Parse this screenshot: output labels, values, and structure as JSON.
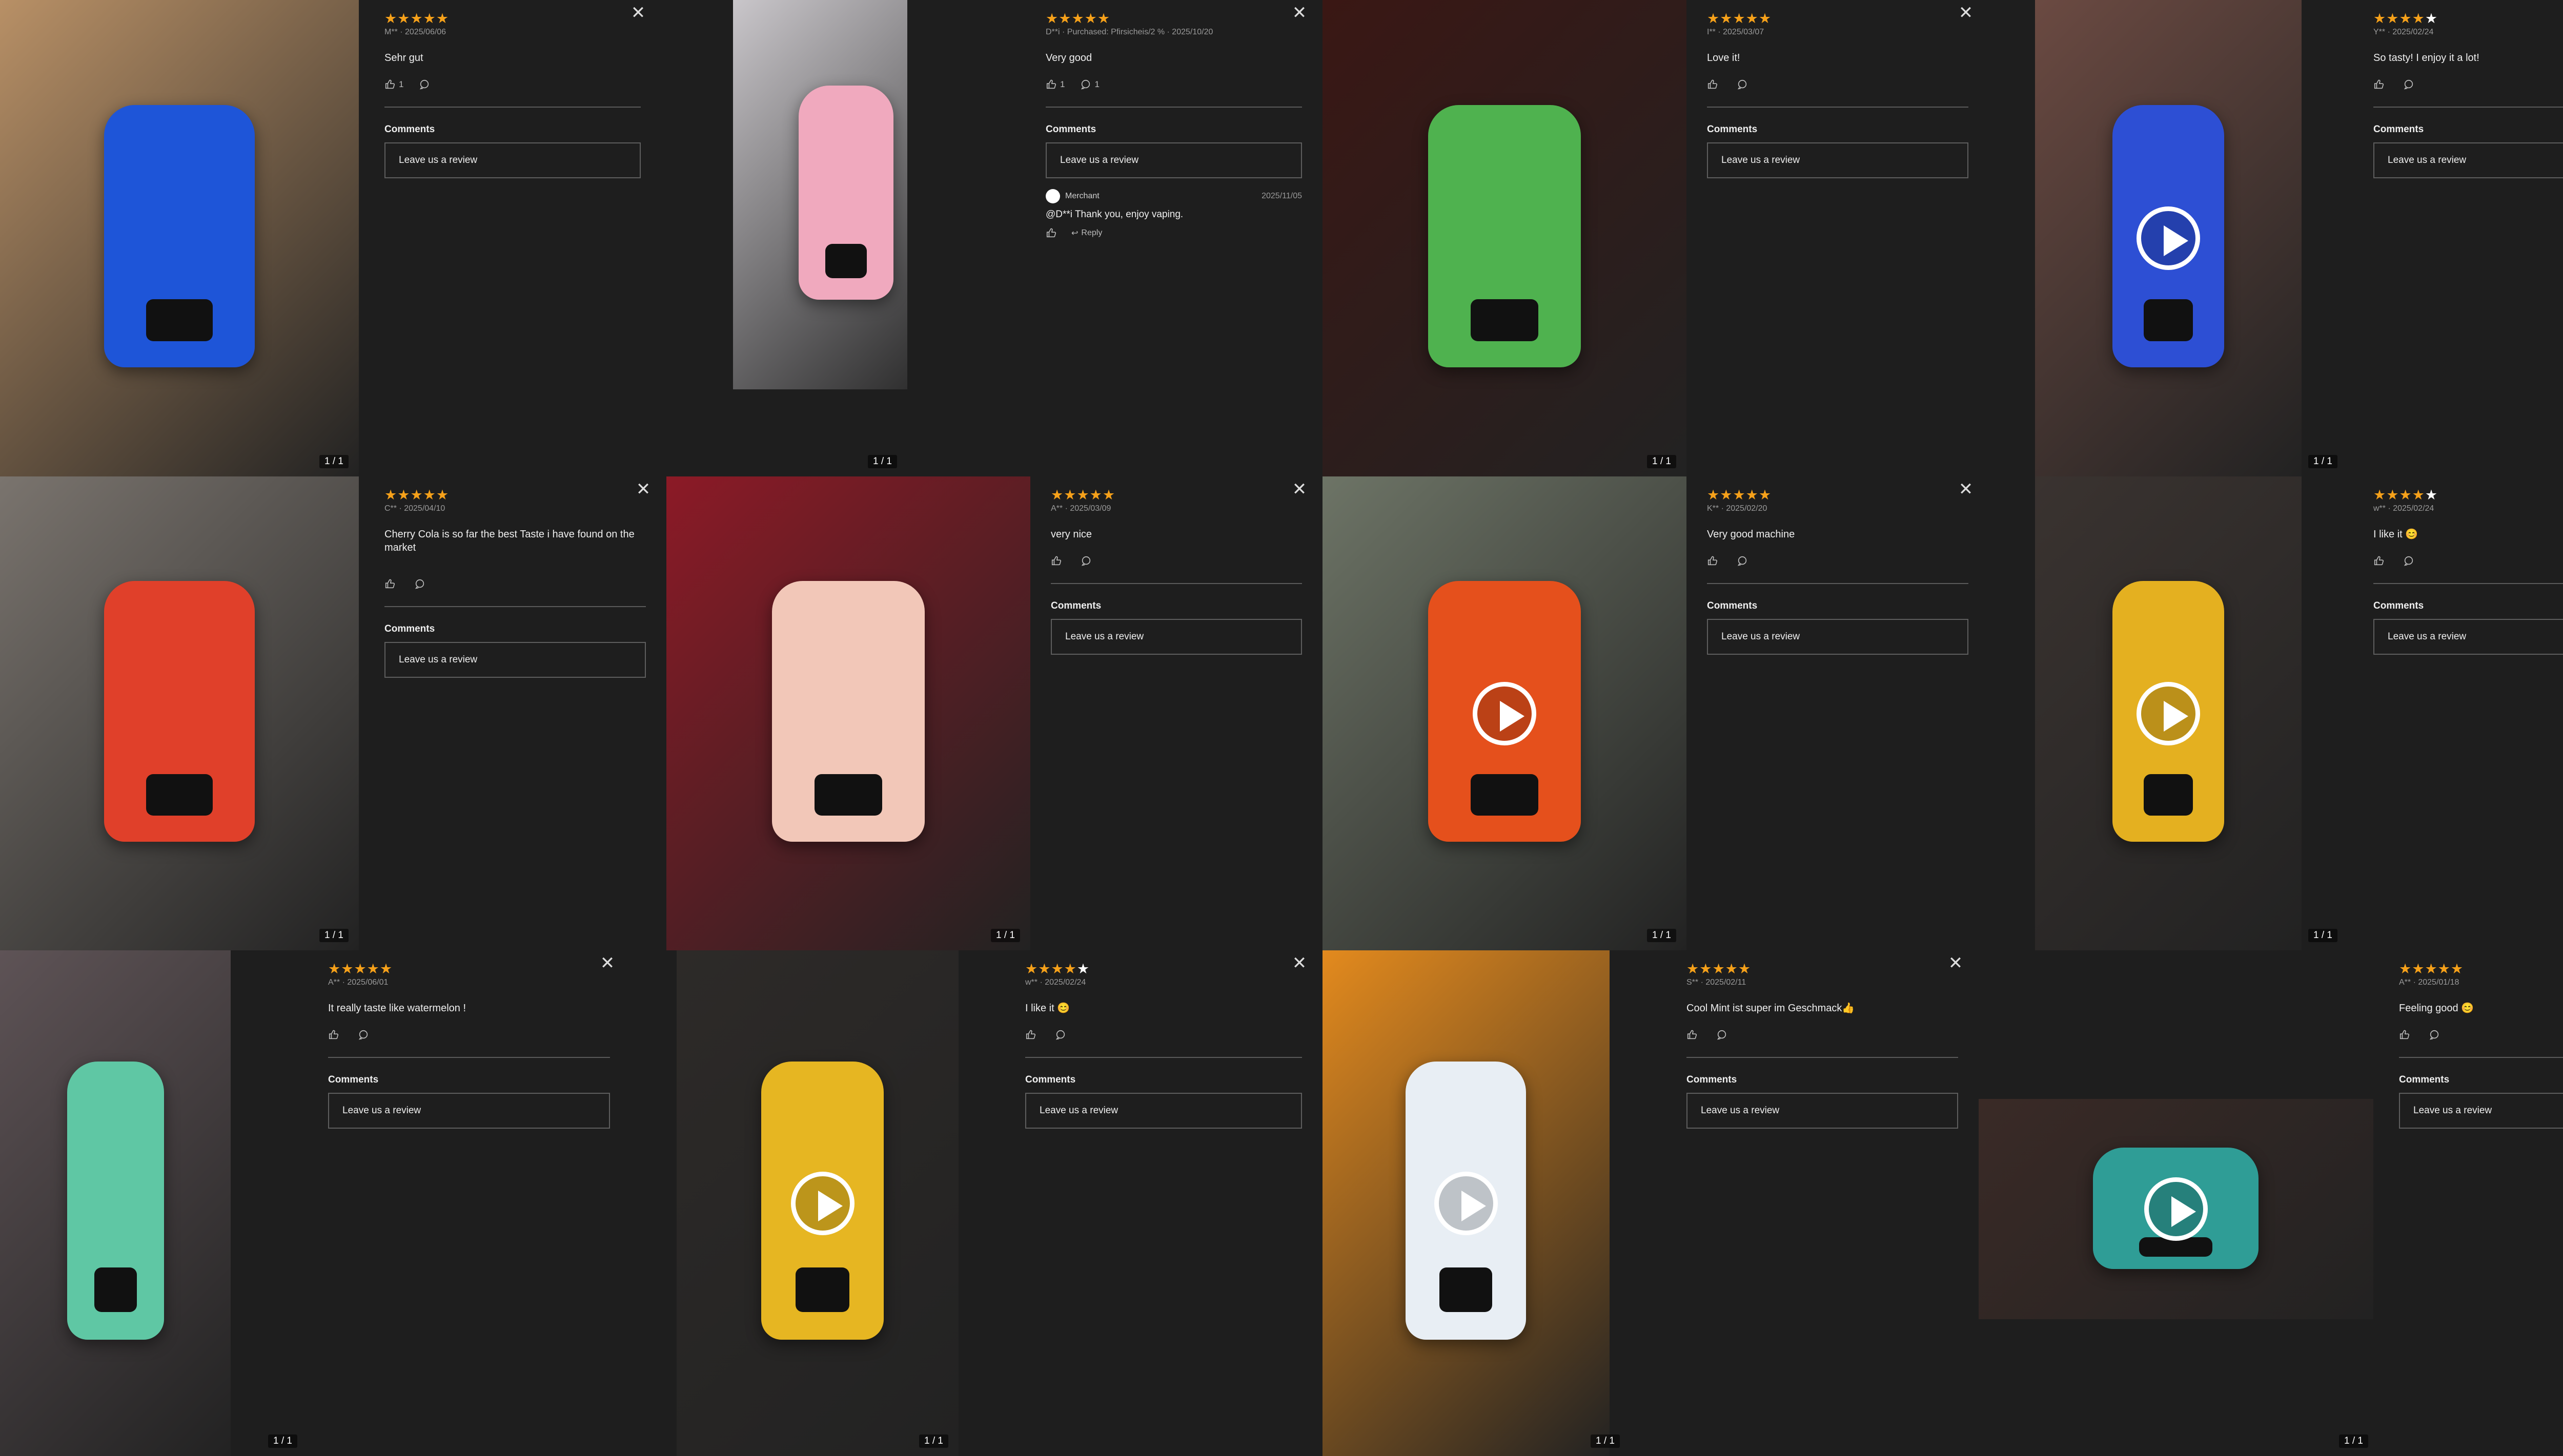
{
  "ui": {
    "close_symbol": "✕",
    "comments_label": "Comments",
    "leave_review_label": "Leave us a review",
    "reply_label": "Reply"
  },
  "reviews": [
    {
      "rating": 5,
      "meta": "M**  ·  2025/06/06",
      "text": "Sehr gut",
      "likes": "1",
      "comments": "",
      "counter": "1 / 1",
      "media_type": "photo",
      "device_color": "#1e55d8",
      "bg_color": "#b89066"
    },
    {
      "rating": 5,
      "meta": "D**i  ·  Purchased: Pfirsicheis/2 %  ·  2025/10/20",
      "text": "Very good",
      "likes": "1",
      "comments": "1",
      "counter": "1 / 1",
      "media_type": "photo",
      "device_color": "#f0a9be",
      "bg_color": "#c9c6ca",
      "reply": {
        "author": "Merchant",
        "date": "2025/11/05",
        "text": "@D**i Thank you, enjoy vaping."
      }
    },
    {
      "rating": 5,
      "meta": "I**  ·  2025/03/07",
      "text": "Love it!",
      "likes": "",
      "comments": "",
      "counter": "1 / 1",
      "media_type": "photo",
      "device_color": "#4fb24f",
      "bg_color": "#3a1714"
    },
    {
      "rating": 4,
      "meta": "Y**  ·  2025/02/24",
      "text": "So tasty! I enjoy it a lot!",
      "likes": "",
      "comments": "",
      "counter": "1 / 1",
      "media_type": "video",
      "device_color": "#2d4fd4",
      "bg_color": "#6b4a42"
    },
    {
      "rating": 5,
      "meta": "C**  ·  2025/04/10",
      "text": "Cherry Cola is so far the best Taste i have found on the market",
      "likes": "",
      "comments": "",
      "counter": "1 / 1",
      "media_type": "photo",
      "device_color": "#e0402a",
      "bg_color": "#7a746e"
    },
    {
      "rating": 5,
      "meta": "A**  ·  2025/03/09",
      "text": "very nice",
      "likes": "",
      "comments": "",
      "counter": "1 / 1",
      "media_type": "photo",
      "device_color": "#f2c7b8",
      "bg_color": "#8c1a26"
    },
    {
      "rating": 5,
      "meta": "K**  ·  2025/02/20",
      "text": "Very good machine",
      "likes": "",
      "comments": "",
      "counter": "1 / 1",
      "media_type": "video",
      "device_color": "#e5501c",
      "bg_color": "#6d7466"
    },
    {
      "rating": 4,
      "meta": "w**  ·  2025/02/24",
      "text": "I like it 😊",
      "likes": "",
      "comments": "",
      "counter": "1 / 1",
      "media_type": "video",
      "device_color": "#e4b020",
      "bg_color": "#3a3330"
    },
    {
      "rating": 5,
      "meta": "A**  ·  2025/06/01",
      "text": "It really taste like watermelon !",
      "likes": "",
      "comments": "",
      "counter": "1 / 1",
      "media_type": "photo",
      "device_color": "#5fc7a4",
      "bg_color": "#5e5356"
    },
    {
      "rating": 4,
      "meta": "w**  ·  2025/02/24",
      "text": "I like it 😊",
      "likes": "",
      "comments": "",
      "counter": "1 / 1",
      "media_type": "video",
      "device_color": "#e6b622",
      "bg_color": "#2d2a28"
    },
    {
      "rating": 5,
      "meta": "S**  ·  2025/02/11",
      "text": "Cool Mint ist super im Geschmack👍",
      "likes": "",
      "comments": "",
      "counter": "1 / 1",
      "media_type": "video",
      "device_color": "#e8eef4",
      "bg_color": "#e38a1e"
    },
    {
      "rating": 5,
      "meta": "A**  ·  2025/01/18",
      "text": "Feeling good 😊",
      "likes": "",
      "comments": "",
      "counter": "1 / 1",
      "media_type": "video",
      "device_color": "#2f9d96",
      "bg_color": "#3a2a26"
    }
  ]
}
